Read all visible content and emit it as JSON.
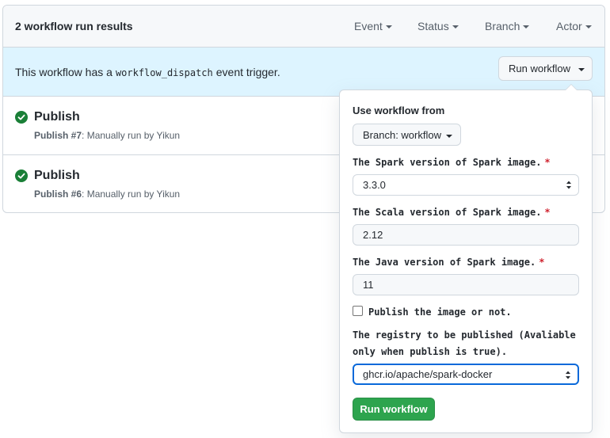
{
  "header": {
    "title": "2 workflow run results",
    "filters": [
      "Event",
      "Status",
      "Branch",
      "Actor"
    ]
  },
  "dispatch": {
    "text_before": "This workflow has a",
    "code": "workflow_dispatch",
    "text_after": "event trigger.",
    "button_label": "Run workflow"
  },
  "runs": [
    {
      "title": "Publish",
      "number": "Publish #7",
      "detail": ": Manually run by Yikun",
      "status": "success"
    },
    {
      "title": "Publish",
      "number": "Publish #6",
      "detail": ": Manually run by Yikun",
      "status": "success"
    }
  ],
  "popover": {
    "use_label": "Use workflow from",
    "branch_button": "Branch: workflow",
    "spark_label": "The Spark version of Spark image.",
    "spark_value": "3.3.0",
    "scala_label": "The Scala version of Spark image.",
    "scala_value": "2.12",
    "java_label": "The Java version of Spark image.",
    "java_value": "11",
    "required_mark": "*",
    "publish_label": "Publish the image or not.",
    "publish_checked": false,
    "registry_label_line1": "The registry to be published (Avaliable",
    "registry_label_line2": "only when publish is true).",
    "registry_value": "ghcr.io/apache/spark-docker",
    "submit_label": "Run workflow"
  },
  "colors": {
    "success": "#1a7f37",
    "submit": "#2da44e",
    "required": "#cf222e",
    "dispatch_bg": "#ddf4ff"
  }
}
